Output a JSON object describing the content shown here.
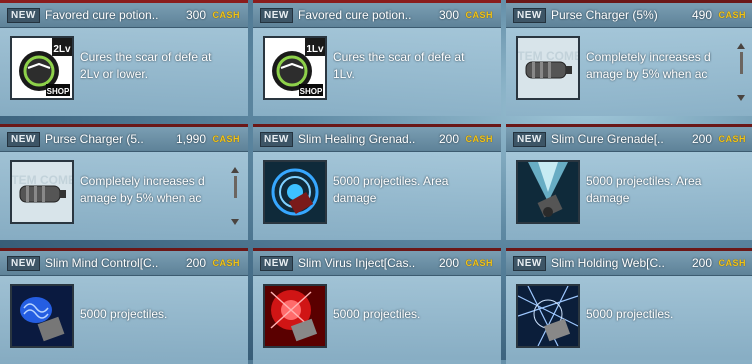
{
  "items": [
    {
      "new_badge": "NEW",
      "name": "Favored cure potion..",
      "price": "300",
      "currency": "CASH",
      "description": "Cures the scar of defe at 2Lv or lower.",
      "icon": "cure-potion-2lv-icon",
      "icon_label": "2Lv",
      "icon_tag": "SHOP"
    },
    {
      "new_badge": "NEW",
      "name": "Favored cure potion..",
      "price": "300",
      "currency": "CASH",
      "description": "Cures the scar of defe at 1Lv.",
      "icon": "cure-potion-1lv-icon",
      "icon_label": "1Lv",
      "icon_tag": "SHOP"
    },
    {
      "new_badge": "NEW",
      "name": "Purse Charger (5%)",
      "price": "490",
      "currency": "CASH",
      "description": "Completely increases d amage by 5% when ac",
      "icon": "purse-charger-icon",
      "icon_tag": "ITEM COME"
    },
    {
      "new_badge": "NEW",
      "name": "Purse Charger (5..",
      "price": "1,990",
      "currency": "CASH",
      "description": "Completely increases d amage by 5% when ac",
      "icon": "purse-charger-icon",
      "icon_tag": "ITEM COME"
    },
    {
      "new_badge": "NEW",
      "name": "Slim Healing Grenad..",
      "price": "200",
      "currency": "CASH",
      "description": "5000 projectiles. Area damage",
      "icon": "healing-grenade-icon"
    },
    {
      "new_badge": "NEW",
      "name": "Slim Cure Grenade[..",
      "price": "200",
      "currency": "CASH",
      "description": "5000 projectiles. Area damage",
      "icon": "cure-grenade-icon"
    },
    {
      "new_badge": "NEW",
      "name": "Slim Mind Control[C..",
      "price": "200",
      "currency": "CASH",
      "description": "5000 projectiles.",
      "icon": "mind-control-icon"
    },
    {
      "new_badge": "NEW",
      "name": "Slim Virus Inject[Cas..",
      "price": "200",
      "currency": "CASH",
      "description": "5000 projectiles.",
      "icon": "virus-inject-icon"
    },
    {
      "new_badge": "NEW",
      "name": "Slim Holding Web[C..",
      "price": "200",
      "currency": "CASH",
      "description": "5000 projectiles.",
      "icon": "holding-web-icon"
    }
  ],
  "colors": {
    "accent": "#f0c419",
    "header": "#6b1717",
    "card_bg": "#a7c8db",
    "text": "#ffffff"
  }
}
